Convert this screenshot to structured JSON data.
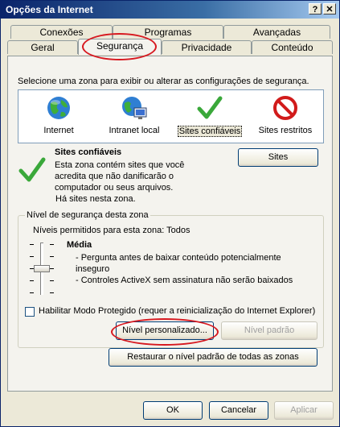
{
  "window": {
    "title": "Opções da Internet",
    "help_button": "?",
    "close_button": "✕"
  },
  "tabs": {
    "row_back": [
      {
        "label": "Conexões"
      },
      {
        "label": "Programas"
      },
      {
        "label": "Avançadas"
      }
    ],
    "row_front": [
      {
        "label": "Geral"
      },
      {
        "label": "Segurança"
      },
      {
        "label": "Privacidade"
      },
      {
        "label": "Conteúdo"
      }
    ],
    "active": "Segurança"
  },
  "zones": {
    "instruction": "Selecione uma zona para exibir ou alterar as configurações de segurança.",
    "items": [
      {
        "label": "Internet",
        "icon": "globe-icon"
      },
      {
        "label": "Intranet local",
        "icon": "intranet-icon"
      },
      {
        "label": "Sites confiáveis",
        "icon": "checkmark-icon"
      },
      {
        "label": "Sites restritos",
        "icon": "restricted-icon"
      }
    ],
    "selected": "Sites confiáveis"
  },
  "zone_info": {
    "title": "Sites confiáveis",
    "line1": "Esta zona contém sites que você",
    "line2": "acredita que não danificarão o",
    "line3": "computador ou seus arquivos.",
    "line4": "Há sites nesta zona.",
    "sites_button": "Sites"
  },
  "security_level": {
    "group_label": "Nível de segurança desta zona",
    "allowed_levels": "Níveis permitidos para esta zona: Todos",
    "level_name": "Média",
    "desc1": "- Pergunta antes de baixar conteúdo potencialmente",
    "desc2": "inseguro",
    "desc3": "- Controles ActiveX sem assinatura não serão baixados",
    "protected_mode": "Habilitar Modo Protegido (requer a reinicialização do Internet Explorer)",
    "protected_mode_checked": false,
    "custom_level_button": "Nível personalizado...",
    "default_level_button": "Nível padrão"
  },
  "restore_button": "Restaurar o nível padrão de todas as zonas",
  "footer": {
    "ok": "OK",
    "cancel": "Cancelar",
    "apply": "Aplicar"
  },
  "colors": {
    "title_bar": "#0a246a",
    "annotation": "#d71920"
  }
}
